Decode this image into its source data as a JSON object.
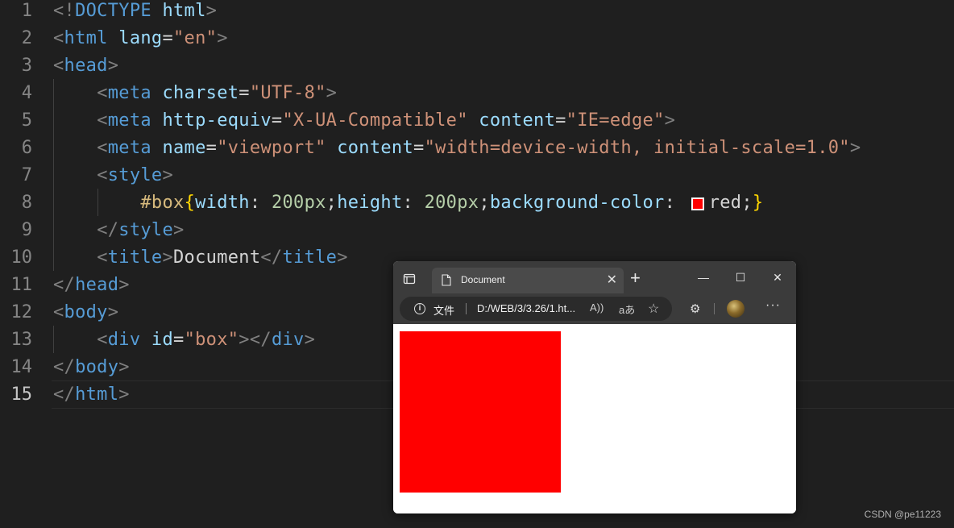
{
  "editor": {
    "lines": [
      {
        "no": "1",
        "segments": [
          [
            "p",
            "<!"
          ],
          [
            "t",
            "DOCTYPE"
          ],
          [
            "x",
            " "
          ],
          [
            "a",
            "html"
          ],
          [
            "p",
            ">"
          ]
        ]
      },
      {
        "no": "2",
        "segments": [
          [
            "p",
            "<"
          ],
          [
            "t",
            "html"
          ],
          [
            "x",
            " "
          ],
          [
            "a",
            "lang"
          ],
          [
            "x",
            "="
          ],
          [
            "s",
            "\"en\""
          ],
          [
            "p",
            ">"
          ]
        ]
      },
      {
        "no": "3",
        "segments": [
          [
            "p",
            "<"
          ],
          [
            "t",
            "head"
          ],
          [
            "p",
            ">"
          ]
        ]
      },
      {
        "no": "4",
        "segments": [
          [
            "x",
            "    "
          ],
          [
            "p",
            "<"
          ],
          [
            "t",
            "meta"
          ],
          [
            "x",
            " "
          ],
          [
            "a",
            "charset"
          ],
          [
            "x",
            "="
          ],
          [
            "s",
            "\"UTF-8\""
          ],
          [
            "p",
            ">"
          ]
        ]
      },
      {
        "no": "5",
        "segments": [
          [
            "x",
            "    "
          ],
          [
            "p",
            "<"
          ],
          [
            "t",
            "meta"
          ],
          [
            "x",
            " "
          ],
          [
            "a",
            "http-equiv"
          ],
          [
            "x",
            "="
          ],
          [
            "s",
            "\"X-UA-Compatible\""
          ],
          [
            "x",
            " "
          ],
          [
            "a",
            "content"
          ],
          [
            "x",
            "="
          ],
          [
            "s",
            "\"IE=edge\""
          ],
          [
            "p",
            ">"
          ]
        ]
      },
      {
        "no": "6",
        "segments": [
          [
            "x",
            "    "
          ],
          [
            "p",
            "<"
          ],
          [
            "t",
            "meta"
          ],
          [
            "x",
            " "
          ],
          [
            "a",
            "name"
          ],
          [
            "x",
            "="
          ],
          [
            "s",
            "\"viewport\""
          ],
          [
            "x",
            " "
          ],
          [
            "a",
            "content"
          ],
          [
            "x",
            "="
          ],
          [
            "s",
            "\"width=device-width, initial-scale=1.0\""
          ],
          [
            "p",
            ">"
          ]
        ]
      },
      {
        "no": "7",
        "segments": [
          [
            "x",
            "    "
          ],
          [
            "p",
            "<"
          ],
          [
            "t",
            "style"
          ],
          [
            "p",
            ">"
          ]
        ]
      },
      {
        "no": "8",
        "segments": [
          [
            "x",
            "        "
          ],
          [
            "c",
            "#box"
          ],
          [
            "b",
            "{"
          ],
          [
            "a",
            "width"
          ],
          [
            "x",
            ": "
          ],
          [
            "n",
            "200px"
          ],
          [
            "x",
            ";"
          ],
          [
            "a",
            "height"
          ],
          [
            "x",
            ": "
          ],
          [
            "n",
            "200px"
          ],
          [
            "x",
            ";"
          ],
          [
            "a",
            "background-color"
          ],
          [
            "x",
            ": "
          ],
          [
            "w",
            ""
          ],
          [
            "x",
            "red;"
          ],
          [
            "b",
            "}"
          ]
        ]
      },
      {
        "no": "9",
        "segments": [
          [
            "x",
            "    "
          ],
          [
            "p",
            "</"
          ],
          [
            "t",
            "style"
          ],
          [
            "p",
            ">"
          ]
        ]
      },
      {
        "no": "10",
        "segments": [
          [
            "x",
            "    "
          ],
          [
            "p",
            "<"
          ],
          [
            "t",
            "title"
          ],
          [
            "p",
            ">"
          ],
          [
            "x",
            "Document"
          ],
          [
            "p",
            "</"
          ],
          [
            "t",
            "title"
          ],
          [
            "p",
            ">"
          ]
        ]
      },
      {
        "no": "11",
        "segments": [
          [
            "p",
            "</"
          ],
          [
            "t",
            "head"
          ],
          [
            "p",
            ">"
          ]
        ]
      },
      {
        "no": "12",
        "segments": [
          [
            "p",
            "<"
          ],
          [
            "t",
            "body"
          ],
          [
            "p",
            ">"
          ]
        ]
      },
      {
        "no": "13",
        "segments": [
          [
            "x",
            "    "
          ],
          [
            "p",
            "<"
          ],
          [
            "t",
            "div"
          ],
          [
            "x",
            " "
          ],
          [
            "a",
            "id"
          ],
          [
            "x",
            "="
          ],
          [
            "s",
            "\"box\""
          ],
          [
            "p",
            "></"
          ],
          [
            "t",
            "div"
          ],
          [
            "p",
            ">"
          ]
        ]
      },
      {
        "no": "14",
        "segments": [
          [
            "p",
            "</"
          ],
          [
            "t",
            "body"
          ],
          [
            "p",
            ">"
          ]
        ]
      },
      {
        "no": "15",
        "segments": [
          [
            "p",
            "</"
          ],
          [
            "t",
            "html"
          ],
          [
            "p",
            ">"
          ]
        ]
      }
    ],
    "active_line": "15",
    "swatch_color": "#ff0000"
  },
  "browser": {
    "tab_title": "Document",
    "tab_close": "✕",
    "new_tab": "+",
    "minimize": "—",
    "maximize": "☐",
    "close": "✕",
    "info_icon": "i",
    "file_label": "文件",
    "url": "D:/WEB/3/3.26/1.ht...",
    "read_aloud_icon": "A))",
    "translate_icon": "aあ",
    "favorites_icon": "☆",
    "extensions_icon": "⚙",
    "more": "···",
    "box_color": "#ff0000"
  },
  "watermark": "CSDN @pe11223"
}
